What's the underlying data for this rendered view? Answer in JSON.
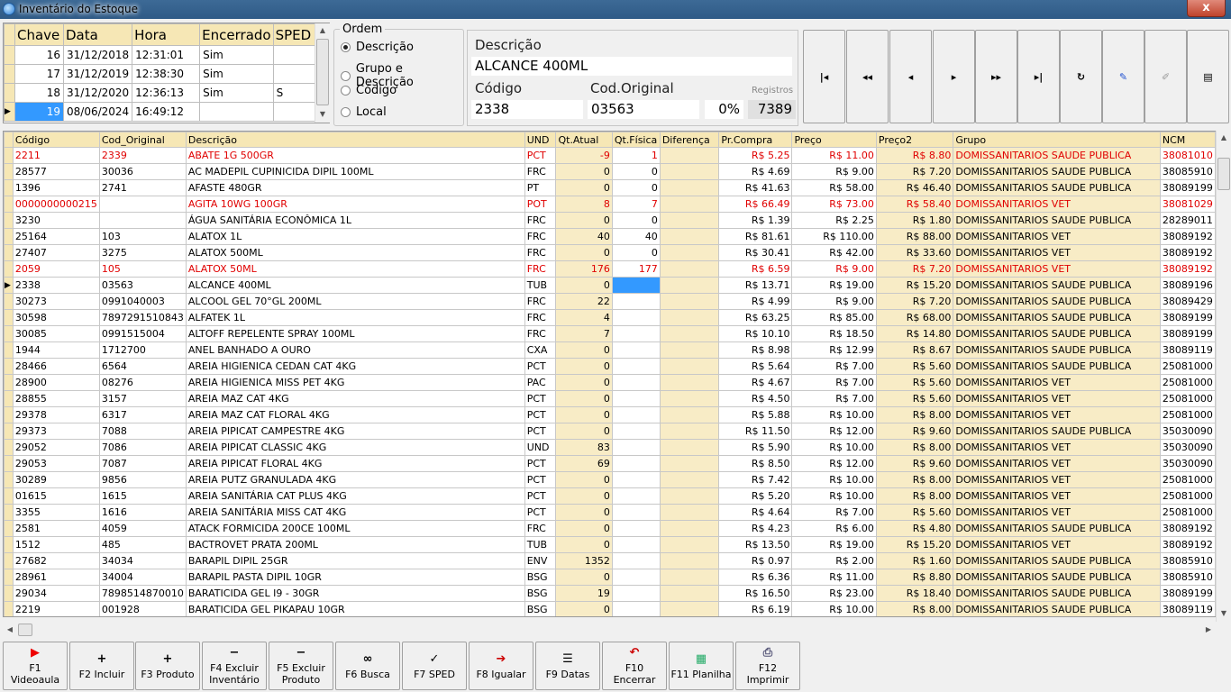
{
  "window": {
    "title": "Inventário do Estoque",
    "close_label": "x"
  },
  "inventories": {
    "headers": [
      "Chave",
      "Data",
      "Hora",
      "Encerrado",
      "SPED"
    ],
    "rows": [
      {
        "chave": "16",
        "data": "31/12/2018",
        "hora": "12:31:01",
        "encerrado": "Sim",
        "sped": ""
      },
      {
        "chave": "17",
        "data": "31/12/2019",
        "hora": "12:38:30",
        "encerrado": "Sim",
        "sped": ""
      },
      {
        "chave": "18",
        "data": "31/12/2020",
        "hora": "12:36:13",
        "encerrado": "Sim",
        "sped": "S"
      },
      {
        "chave": "19",
        "data": "08/06/2024",
        "hora": "16:49:12",
        "encerrado": "",
        "sped": ""
      }
    ]
  },
  "ordem": {
    "legend": "Ordem",
    "options": [
      "Descrição",
      "Grupo e Descrição",
      "Código",
      "Local"
    ],
    "selected": "Descrição"
  },
  "info": {
    "descricao_label": "Descrição",
    "descricao_value": "ALCANCE 400ML",
    "codigo_label": "Código",
    "codigo_value": "2338",
    "cod_original_label": "Cod.Original",
    "cod_original_value": "03563",
    "percent": "0%",
    "registros_label": "Registros",
    "registros_value": "7389"
  },
  "navigator": [
    "first-icon",
    "prior-page-icon",
    "prior-icon",
    "next-icon",
    "next-page-icon",
    "last-icon",
    "refresh-icon",
    "edit-icon",
    "post-icon",
    "window-icon"
  ],
  "grid": {
    "headers": [
      "Código",
      "Cod_Original",
      "Descrição",
      "UND",
      "Qt.Atual",
      "Qt.Física",
      "Diferença",
      "Pr.Compra",
      "Preço",
      "Preço2",
      "Grupo",
      "NCM"
    ],
    "rows": [
      {
        "c": "2211",
        "o": "2339",
        "d": "ABATE 1G 500GR",
        "u": "PCT",
        "a": "-9",
        "f": "1",
        "pc": "R$ 5.25",
        "p": "R$ 11.00",
        "p2": "R$ 8.80",
        "g": "DOMISSANITARIOS SAUDE PUBLICA",
        "n": "38081010",
        "red": true
      },
      {
        "c": "28577",
        "o": "30036",
        "d": "AC MADEPIL CUPINICIDA DIPIL 100ML",
        "u": "FRC",
        "a": "0",
        "f": "0",
        "pc": "R$ 4.69",
        "p": "R$ 9.00",
        "p2": "R$ 7.20",
        "g": "DOMISSANITARIOS SAUDE PUBLICA",
        "n": "38085910"
      },
      {
        "c": "1396",
        "o": "2741",
        "d": "AFASTE 480GR",
        "u": "PT",
        "a": "0",
        "f": "0",
        "pc": "R$ 41.63",
        "p": "R$ 58.00",
        "p2": "R$ 46.40",
        "g": "DOMISSANITARIOS SAUDE PUBLICA",
        "n": "38089199"
      },
      {
        "c": "0000000000215",
        "o": "",
        "d": "AGITA 10WG 100GR",
        "u": "POT",
        "a": "8",
        "f": "7",
        "pc": "R$ 66.49",
        "p": "R$ 73.00",
        "p2": "R$ 58.40",
        "g": "DOMISSANITARIOS VET",
        "n": "38081029",
        "red": true
      },
      {
        "c": "3230",
        "o": "",
        "d": "ÁGUA SANITÁRIA ECONÔMICA 1L",
        "u": "FRC",
        "a": "0",
        "f": "0",
        "pc": "R$ 1.39",
        "p": "R$ 2.25",
        "p2": "R$ 1.80",
        "g": "DOMISSANITARIOS SAUDE PUBLICA",
        "n": "28289011"
      },
      {
        "c": "25164",
        "o": "103",
        "d": "ALATOX 1L",
        "u": "FRC",
        "a": "40",
        "f": "40",
        "pc": "R$ 81.61",
        "p": "R$ 110.00",
        "p2": "R$ 88.00",
        "g": "DOMISSANITARIOS VET",
        "n": "38089192"
      },
      {
        "c": "27407",
        "o": "3275",
        "d": "ALATOX 500ML",
        "u": "FRC",
        "a": "0",
        "f": "0",
        "pc": "R$ 30.41",
        "p": "R$ 42.00",
        "p2": "R$ 33.60",
        "g": "DOMISSANITARIOS VET",
        "n": "38089192"
      },
      {
        "c": "2059",
        "o": "105",
        "d": "ALATOX 50ML",
        "u": "FRC",
        "a": "176",
        "f": "177",
        "pc": "R$ 6.59",
        "p": "R$ 9.00",
        "p2": "R$ 7.20",
        "g": "DOMISSANITARIOS VET",
        "n": "38089192",
        "red": true
      },
      {
        "c": "2338",
        "o": "03563",
        "d": "ALCANCE 400ML",
        "u": "TUB",
        "a": "0",
        "f": "",
        "pc": "R$ 13.71",
        "p": "R$ 19.00",
        "p2": "R$ 15.20",
        "g": "DOMISSANITARIOS SAUDE PUBLICA",
        "n": "38089196",
        "current": true
      },
      {
        "c": "30273",
        "o": "0991040003",
        "d": "ALCOOL GEL 70°GL 200ML",
        "u": "FRC",
        "a": "22",
        "f": "",
        "pc": "R$ 4.99",
        "p": "R$ 9.00",
        "p2": "R$ 7.20",
        "g": "DOMISSANITARIOS SAUDE PUBLICA",
        "n": "38089429"
      },
      {
        "c": "30598",
        "o": "7897291510843",
        "d": "ALFATEK 1L",
        "u": "FRC",
        "a": "4",
        "f": "",
        "pc": "R$ 63.25",
        "p": "R$ 85.00",
        "p2": "R$ 68.00",
        "g": "DOMISSANITARIOS SAUDE PUBLICA",
        "n": "38089199"
      },
      {
        "c": "30085",
        "o": "0991515004",
        "d": "ALTOFF REPELENTE SPRAY 100ML",
        "u": "FRC",
        "a": "7",
        "f": "",
        "pc": "R$ 10.10",
        "p": "R$ 18.50",
        "p2": "R$ 14.80",
        "g": "DOMISSANITARIOS SAUDE PUBLICA",
        "n": "38089199"
      },
      {
        "c": "1944",
        "o": "1712700",
        "d": "ANEL BANHADO A OURO",
        "u": "CXA",
        "a": "0",
        "f": "",
        "pc": "R$ 8.98",
        "p": "R$ 12.99",
        "p2": "R$ 8.67",
        "g": "DOMISSANITARIOS SAUDE PUBLICA",
        "n": "38089119"
      },
      {
        "c": "28466",
        "o": "6564",
        "d": "AREIA HIGIENICA CEDAN CAT 4KG",
        "u": "PCT",
        "a": "0",
        "f": "",
        "pc": "R$ 5.64",
        "p": "R$ 7.00",
        "p2": "R$ 5.60",
        "g": "DOMISSANITARIOS SAUDE PUBLICA",
        "n": "25081000"
      },
      {
        "c": "28900",
        "o": "08276",
        "d": "AREIA HIGIENICA MISS PET 4KG",
        "u": "PAC",
        "a": "0",
        "f": "",
        "pc": "R$ 4.67",
        "p": "R$ 7.00",
        "p2": "R$ 5.60",
        "g": "DOMISSANITARIOS VET",
        "n": "25081000"
      },
      {
        "c": "28855",
        "o": "3157",
        "d": "AREIA MAZ CAT 4KG",
        "u": "PCT",
        "a": "0",
        "f": "",
        "pc": "R$ 4.50",
        "p": "R$ 7.00",
        "p2": "R$ 5.60",
        "g": "DOMISSANITARIOS VET",
        "n": "25081000"
      },
      {
        "c": "29378",
        "o": "6317",
        "d": "AREIA MAZ CAT FLORAL 4KG",
        "u": "PCT",
        "a": "0",
        "f": "",
        "pc": "R$ 5.88",
        "p": "R$ 10.00",
        "p2": "R$ 8.00",
        "g": "DOMISSANITARIOS VET",
        "n": "25081000"
      },
      {
        "c": "29373",
        "o": "7088",
        "d": "AREIA PIPICAT CAMPESTRE 4KG",
        "u": "PCT",
        "a": "0",
        "f": "",
        "pc": "R$ 11.50",
        "p": "R$ 12.00",
        "p2": "R$ 9.60",
        "g": "DOMISSANITARIOS SAUDE PUBLICA",
        "n": "35030090"
      },
      {
        "c": "29052",
        "o": "7086",
        "d": "AREIA PIPICAT CLASSIC 4KG",
        "u": "UND",
        "a": "83",
        "f": "",
        "pc": "R$ 5.90",
        "p": "R$ 10.00",
        "p2": "R$ 8.00",
        "g": "DOMISSANITARIOS VET",
        "n": "35030090"
      },
      {
        "c": "29053",
        "o": "7087",
        "d": "AREIA PIPICAT FLORAL 4KG",
        "u": "PCT",
        "a": "69",
        "f": "",
        "pc": "R$ 8.50",
        "p": "R$ 12.00",
        "p2": "R$ 9.60",
        "g": "DOMISSANITARIOS VET",
        "n": "35030090"
      },
      {
        "c": "30289",
        "o": "9856",
        "d": "AREIA PUTZ GRANULADA 4KG",
        "u": "PCT",
        "a": "0",
        "f": "",
        "pc": "R$ 7.42",
        "p": "R$ 10.00",
        "p2": "R$ 8.00",
        "g": "DOMISSANITARIOS VET",
        "n": "25081000"
      },
      {
        "c": "01615",
        "o": "1615",
        "d": "AREIA SANITÁRIA CAT PLUS 4KG",
        "u": "PCT",
        "a": "0",
        "f": "",
        "pc": "R$ 5.20",
        "p": "R$ 10.00",
        "p2": "R$ 8.00",
        "g": "DOMISSANITARIOS VET",
        "n": "25081000"
      },
      {
        "c": "3355",
        "o": "1616",
        "d": "AREIA SANITÁRIA MISS CAT 4KG",
        "u": "PCT",
        "a": "0",
        "f": "",
        "pc": "R$ 4.64",
        "p": "R$ 7.00",
        "p2": "R$ 5.60",
        "g": "DOMISSANITARIOS VET",
        "n": "25081000"
      },
      {
        "c": "2581",
        "o": "4059",
        "d": "ATACK FORMICIDA 200CE 100ML",
        "u": "FRC",
        "a": "0",
        "f": "",
        "pc": "R$ 4.23",
        "p": "R$ 6.00",
        "p2": "R$ 4.80",
        "g": "DOMISSANITARIOS SAUDE PUBLICA",
        "n": "38089192"
      },
      {
        "c": "1512",
        "o": "485",
        "d": "BACTROVET PRATA 200ML",
        "u": "TUB",
        "a": "0",
        "f": "",
        "pc": "R$ 13.50",
        "p": "R$ 19.00",
        "p2": "R$ 15.20",
        "g": "DOMISSANITARIOS VET",
        "n": "38089192"
      },
      {
        "c": "27682",
        "o": "34034",
        "d": "BARAPIL DIPIL 25GR",
        "u": "ENV",
        "a": "1352",
        "f": "",
        "pc": "R$ 0.97",
        "p": "R$ 2.00",
        "p2": "R$ 1.60",
        "g": "DOMISSANITARIOS SAUDE PUBLICA",
        "n": "38085910"
      },
      {
        "c": "28961",
        "o": "34004",
        "d": "BARAPIL PASTA DIPIL 10GR",
        "u": "BSG",
        "a": "0",
        "f": "",
        "pc": "R$ 6.36",
        "p": "R$ 11.00",
        "p2": "R$ 8.80",
        "g": "DOMISSANITARIOS SAUDE PUBLICA",
        "n": "38085910"
      },
      {
        "c": "29034",
        "o": "7898514870010",
        "d": "BARATICIDA GEL I9 - 30GR",
        "u": "BSG",
        "a": "19",
        "f": "",
        "pc": "R$ 16.50",
        "p": "R$ 23.00",
        "p2": "R$ 18.40",
        "g": "DOMISSANITARIOS SAUDE PUBLICA",
        "n": "38089199"
      },
      {
        "c": "2219",
        "o": "001928",
        "d": "BARATICIDA GEL PIKAPAU 10GR",
        "u": "BSG",
        "a": "0",
        "f": "",
        "pc": "R$ 6.19",
        "p": "R$ 10.00",
        "p2": "R$ 8.00",
        "g": "DOMISSANITARIOS SAUDE PUBLICA",
        "n": "38089119"
      }
    ]
  },
  "toolbar": [
    {
      "label": "F1 Videoaula",
      "icon": "youtube-icon"
    },
    {
      "label": "F2 Incluir",
      "icon": "plus-icon"
    },
    {
      "label": "F3 Produto",
      "icon": "plus-icon"
    },
    {
      "label": "F4 Excluir Inventário",
      "icon": "minus-icon"
    },
    {
      "label": "F5 Excluir Produto",
      "icon": "minus-icon"
    },
    {
      "label": "F6 Busca",
      "icon": "binoculars-icon"
    },
    {
      "label": "F7 SPED",
      "icon": "check-icon"
    },
    {
      "label": "F8 Igualar",
      "icon": "equalize-icon"
    },
    {
      "label": "F9 Datas",
      "icon": "list-icon"
    },
    {
      "label": "F10 Encerrar",
      "icon": "close-inventory-icon"
    },
    {
      "label": "F11 Planilha",
      "icon": "spreadsheet-icon"
    },
    {
      "label": "F12 Imprimir",
      "icon": "printer-icon"
    }
  ]
}
